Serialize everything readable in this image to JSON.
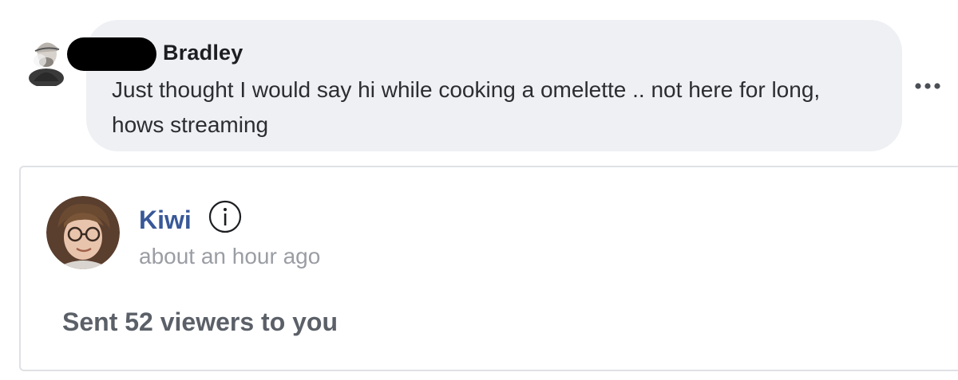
{
  "comment": {
    "author_name": "Bradley",
    "text": "Just thought I would say hi while cooking a omelette .. not here for long, hows streaming",
    "avatar_icon": "user-avatar-icon",
    "more_icon": "more-options-icon"
  },
  "notification": {
    "sender_name": "Kiwi",
    "time": "about an hour ago",
    "message": "Sent 52 viewers to you",
    "info_icon": "info-icon",
    "avatar_icon": "user-avatar-icon"
  },
  "colors": {
    "bubble_background": "#eef0f4",
    "link_blue": "#385898",
    "muted_gray": "#9a9da3",
    "card_border": "#dfe1e5"
  }
}
